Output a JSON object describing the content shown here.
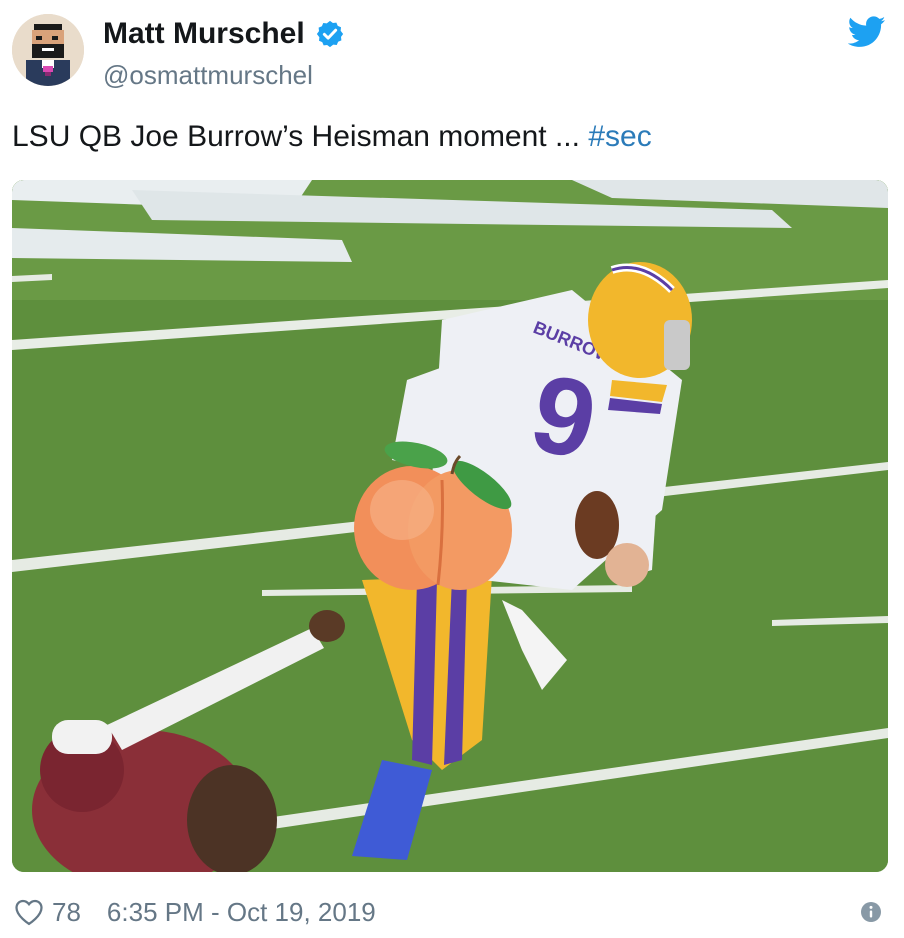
{
  "author": {
    "display_name": "Matt Murschel",
    "handle": "@osmattmurschel",
    "verified": true
  },
  "tweet": {
    "text": "LSU QB Joe Burrow’s Heisman moment ... ",
    "hashtag": "#sec"
  },
  "media": {
    "jersey_name": "BURROW",
    "jersey_number": "9"
  },
  "footer": {
    "like_count": "78",
    "timestamp": "6:35 PM - Oct 19, 2019"
  },
  "colors": {
    "twitter_blue": "#1da1f2",
    "link_blue": "#2b7bb9",
    "secondary_text": "#657786",
    "field_green": "#5c8e3c",
    "lsu_purple": "#5b3ea5",
    "lsu_gold": "#f5b325"
  },
  "icons": {
    "verified": "verified-badge-icon",
    "logo": "twitter-bird-icon",
    "like": "heart-outline-icon",
    "info": "info-circle-icon"
  }
}
